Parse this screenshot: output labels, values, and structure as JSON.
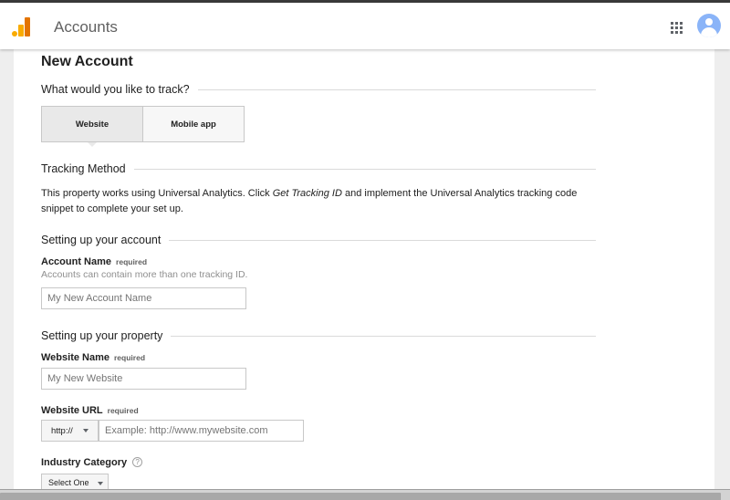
{
  "header": {
    "title": "Accounts"
  },
  "page": {
    "title": "New Account"
  },
  "track": {
    "heading": "What would you like to track?",
    "options": [
      {
        "label": "Website",
        "selected": true
      },
      {
        "label": "Mobile app",
        "selected": false
      }
    ]
  },
  "tracking_method": {
    "heading": "Tracking Method",
    "text_before": "This property works using Universal Analytics. Click ",
    "text_em": "Get Tracking ID",
    "text_after": " and implement the Universal Analytics tracking code snippet to complete your set up."
  },
  "account": {
    "heading": "Setting up your account",
    "name_label": "Account Name",
    "required": "required",
    "help": "Accounts can contain more than one tracking ID.",
    "name_placeholder": "My New Account Name"
  },
  "property": {
    "heading": "Setting up your property",
    "website_name_label": "Website Name",
    "required": "required",
    "website_name_placeholder": "My New Website",
    "website_url_label": "Website URL",
    "protocol": "http://",
    "url_placeholder": "Example: http://www.mywebsite.com",
    "industry_label": "Industry Category",
    "help_glyph": "?",
    "industry_value": "Select One"
  },
  "icons": {
    "logo": "analytics-logo-icon",
    "apps": "apps-grid-icon",
    "avatar": "account-avatar-icon",
    "help": "help-icon",
    "dropdown": "chevron-down-icon"
  },
  "colors": {
    "logo_light": "#f9ab00",
    "logo_dark": "#e37400",
    "avatar": "#8ab4f8",
    "background": "#eeeeee"
  }
}
